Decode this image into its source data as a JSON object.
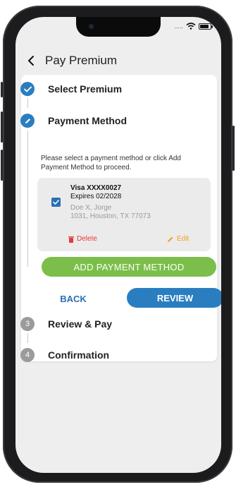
{
  "status_bar": {
    "signal_dots": "....."
  },
  "header": {
    "title": "Pay Premium"
  },
  "steps": [
    {
      "number": "",
      "label": "Select Premium",
      "state": "completed"
    },
    {
      "number": "",
      "label": "Payment Method",
      "state": "active"
    },
    {
      "number": "3",
      "label": "Review & Pay",
      "state": "pending"
    },
    {
      "number": "4",
      "label": "Confirmation",
      "state": "pending"
    }
  ],
  "payment": {
    "instructions": "Please select a payment method or click Add Payment Method to proceed.",
    "card": {
      "name": "Visa XXXX0027",
      "expires": "Expires 02/2028",
      "holder": "Doe X, Jorge",
      "address": "1031, Houston, TX 77073",
      "selected": true,
      "delete_label": "Delete",
      "edit_label": "Edit"
    },
    "add_button": "ADD PAYMENT METHOD"
  },
  "actions": {
    "back": "BACK",
    "review": "REVIEW"
  },
  "colors": {
    "primary": "#2a7ec0",
    "green": "#7bbf4a",
    "delete": "#e53935",
    "edit": "#f0a020"
  }
}
